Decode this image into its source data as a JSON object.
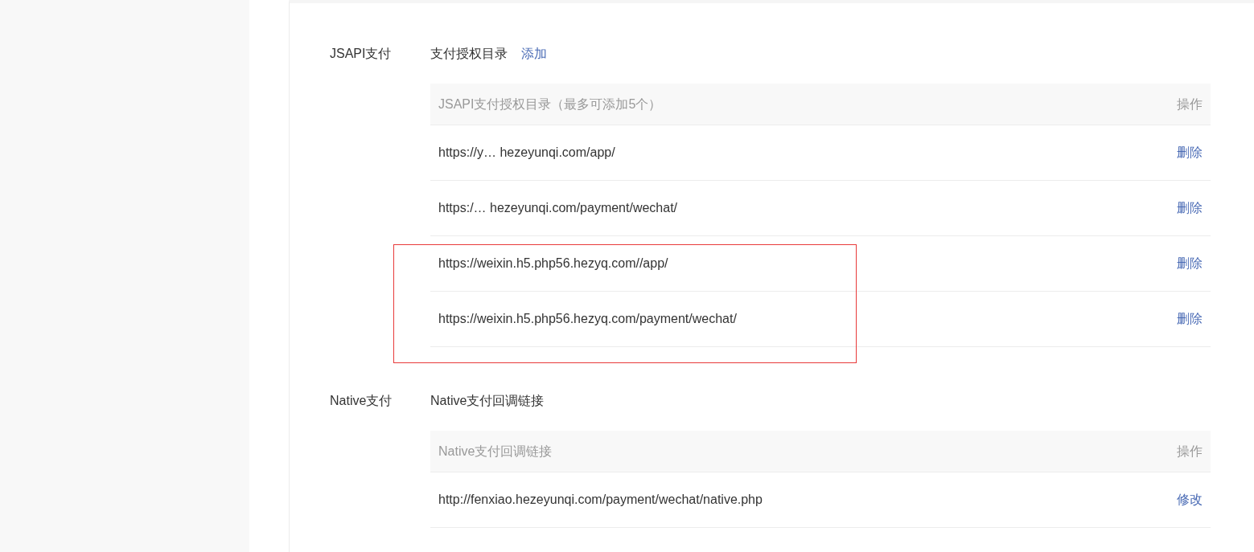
{
  "sections": [
    {
      "label": "JSAPI支付",
      "title": "支付授权目录",
      "title_action": "添加",
      "table": {
        "header": "JSAPI支付授权目录（最多可添加5个）",
        "action_header": "操作",
        "rows": [
          {
            "url": "https://y… hezeyunqi.com/app/",
            "action": "删除",
            "highlighted": false
          },
          {
            "url": "https:/… hezeyunqi.com/payment/wechat/",
            "action": "删除",
            "highlighted": false
          },
          {
            "url": "https://weixin.h5.php56.hezyq.com//app/",
            "action": "删除",
            "highlighted": true
          },
          {
            "url": "https://weixin.h5.php56.hezyq.com/payment/wechat/",
            "action": "删除",
            "highlighted": true
          }
        ]
      }
    },
    {
      "label": "Native支付",
      "title": "Native支付回调链接",
      "table": {
        "header": "Native支付回调链接",
        "action_header": "操作",
        "rows": [
          {
            "url": "http://fenxiao.hezeyunqi.com/payment/wechat/native.php",
            "action": "修改",
            "highlighted": false
          }
        ]
      }
    }
  ]
}
